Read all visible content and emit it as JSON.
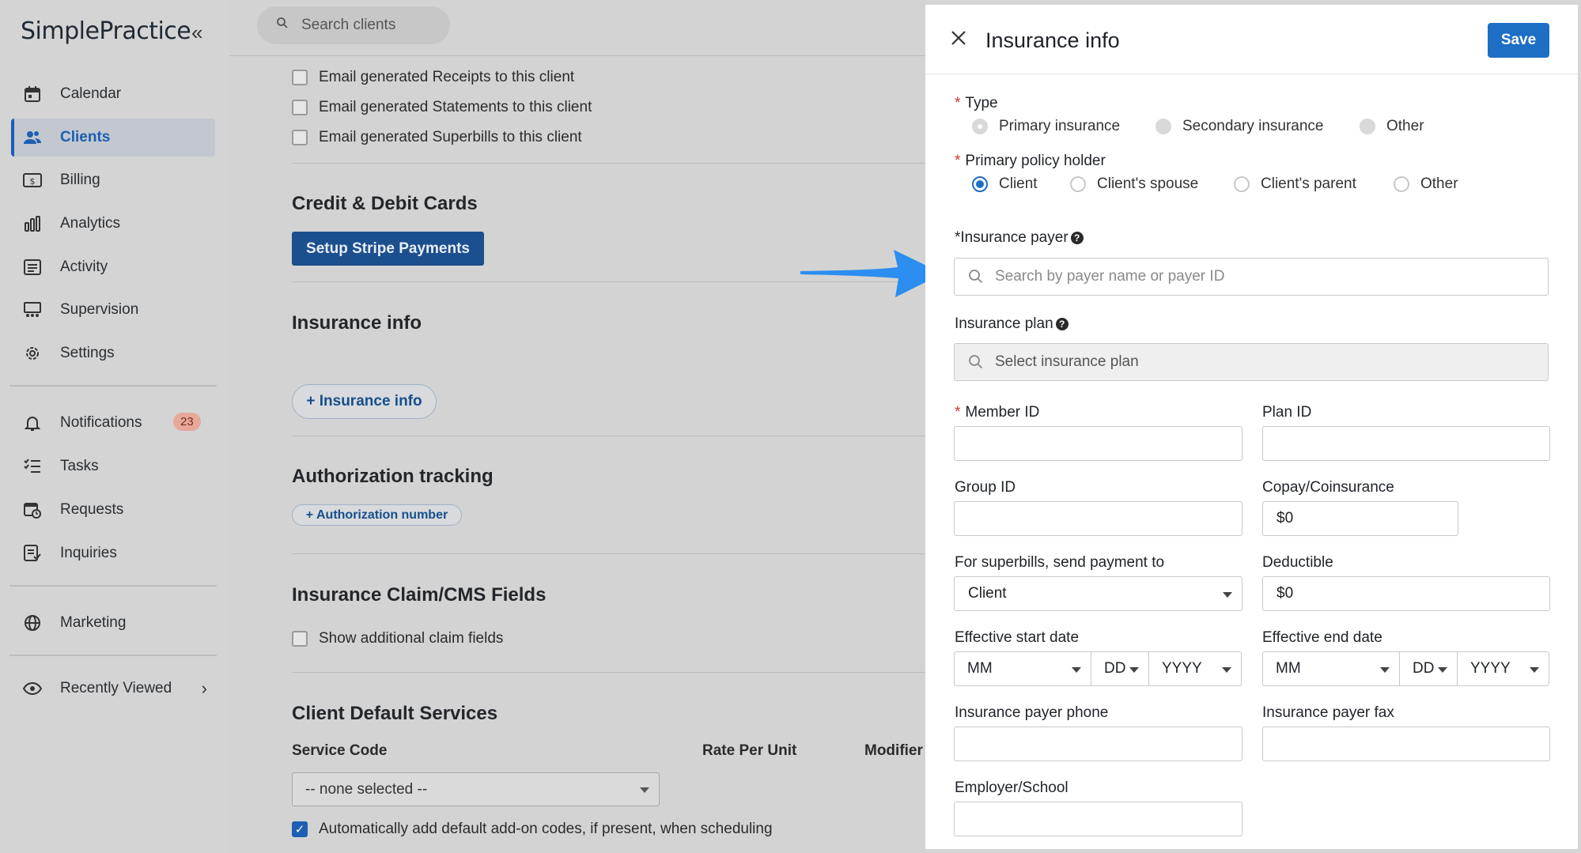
{
  "app": {
    "logo": "SimplePractice",
    "collapse_icon": "«"
  },
  "sidebar": {
    "items": [
      {
        "label": "Calendar",
        "icon": "calendar-icon"
      },
      {
        "label": "Clients",
        "icon": "users-icon",
        "active": true
      },
      {
        "label": "Billing",
        "icon": "billing-icon"
      },
      {
        "label": "Analytics",
        "icon": "analytics-icon"
      },
      {
        "label": "Activity",
        "icon": "activity-icon"
      },
      {
        "label": "Supervision",
        "icon": "supervision-icon"
      },
      {
        "label": "Settings",
        "icon": "gear-icon"
      }
    ],
    "items2": [
      {
        "label": "Notifications",
        "icon": "bell-icon",
        "badge": "23"
      },
      {
        "label": "Tasks",
        "icon": "tasks-icon"
      },
      {
        "label": "Requests",
        "icon": "requests-icon"
      },
      {
        "label": "Inquiries",
        "icon": "inquiries-icon"
      }
    ],
    "marketing": {
      "label": "Marketing",
      "icon": "globe-icon"
    },
    "recently_viewed": {
      "label": "Recently Viewed",
      "icon": "eye-icon"
    }
  },
  "main": {
    "search_placeholder": "Search clients",
    "email_options": [
      "Email generated Receipts to this client",
      "Email generated Statements to this client",
      "Email generated Superbills to this client"
    ],
    "credit_title": "Credit & Debit Cards",
    "stripe_button": "Setup Stripe Payments",
    "insurance_title": "Insurance info",
    "insurance_button": "+ Insurance info",
    "auth_title": "Authorization tracking",
    "auth_button": "+ Authorization number",
    "claim_title": "Insurance Claim/CMS Fields",
    "claim_option": "Show additional claim fields",
    "services_title": "Client Default Services",
    "col_service": "Service Code",
    "col_rate": "Rate Per Unit",
    "col_modifier": "Modifier",
    "service_select": "-- none selected --",
    "auto_addon": "Automatically add default add-on codes, if present, when scheduling"
  },
  "panel": {
    "title": "Insurance info",
    "save": "Save",
    "type_label": "Type",
    "type_options": [
      "Primary insurance",
      "Secondary insurance",
      "Other"
    ],
    "holder_label": "Primary policy holder",
    "holder_options": [
      "Client",
      "Client's spouse",
      "Client's parent",
      "Other"
    ],
    "payer_label": "*Insurance payer",
    "payer_placeholder": "Search by payer name or payer ID",
    "plan_label": "Insurance plan",
    "plan_placeholder": "Select insurance plan",
    "member_id": "Member ID",
    "plan_id": "Plan ID",
    "group_id": "Group ID",
    "copay": "Copay/Coinsurance",
    "copay_value": "$0",
    "superbills": "For superbills, send payment to",
    "superbills_value": "Client",
    "deductible": "Deductible",
    "deductible_value": "$0",
    "start_date": "Effective start date",
    "end_date": "Effective end date",
    "date_mm": "MM",
    "date_dd": "DD",
    "date_yyyy": "YYYY",
    "payer_phone": "Insurance payer phone",
    "payer_fax": "Insurance payer fax",
    "employer": "Employer/School"
  },
  "colors": {
    "accent": "#1d6ec5",
    "required": "#d9322b",
    "arrow": "#2b8ef0"
  }
}
